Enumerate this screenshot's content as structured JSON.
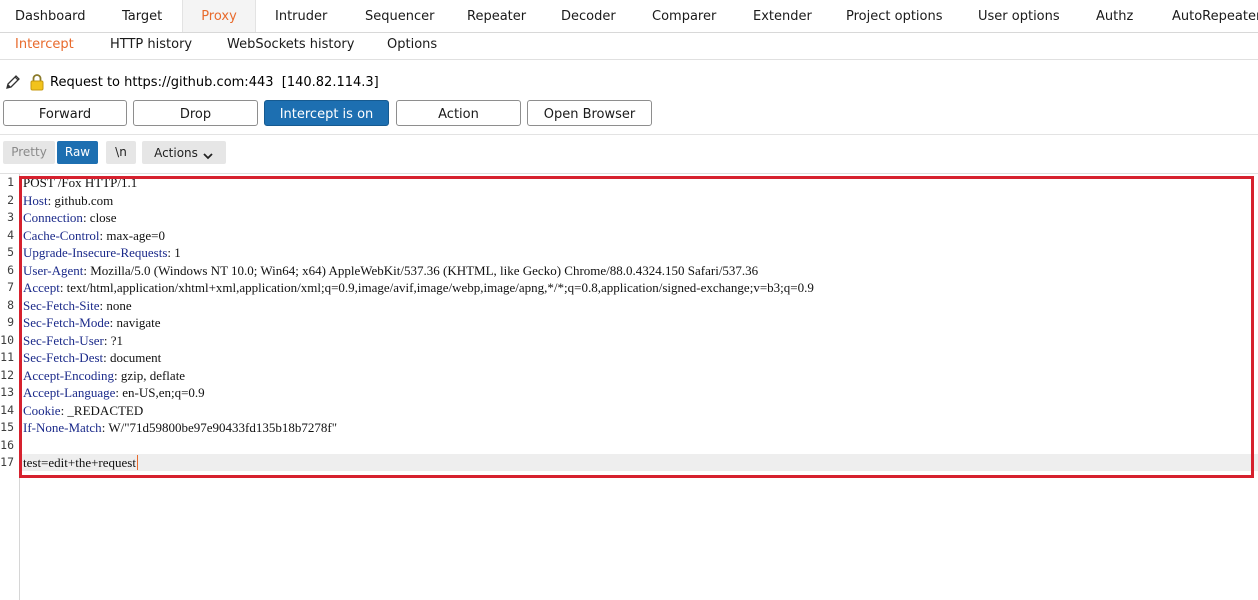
{
  "main_tabs": [
    "Dashboard",
    "Target",
    "Proxy",
    "Intruder",
    "Sequencer",
    "Repeater",
    "Decoder",
    "Comparer",
    "Extender",
    "Project options",
    "User options",
    "Authz",
    "AutoRepeater"
  ],
  "active_main_tab": "Proxy",
  "sub_tabs": [
    "Intercept",
    "HTTP history",
    "WebSockets history",
    "Options"
  ],
  "active_sub_tab": "Intercept",
  "request_info": "Request to https://github.com:443  [140.82.114.3]",
  "icons": {
    "edit": "pencil-icon",
    "lock": "lock-icon",
    "dropdown": "chevron-down-icon"
  },
  "buttons": {
    "forward": "Forward",
    "drop": "Drop",
    "intercept": "Intercept is on",
    "action": "Action",
    "open_browser": "Open Browser"
  },
  "message_view": {
    "pretty": "Pretty",
    "raw": "Raw",
    "newline": "\\n",
    "actions": "Actions"
  },
  "colors": {
    "accent": "#e86a2c",
    "primary": "#1d6fb1",
    "highlight_box": "#d6212e",
    "header_key": "#1b2a8a"
  },
  "request_lines": [
    {
      "n": "1",
      "key": "",
      "val": "POST /Fox HTTP/1.1"
    },
    {
      "n": "2",
      "key": "Host",
      "val": ": github.com"
    },
    {
      "n": "3",
      "key": "Connection",
      "val": ": close"
    },
    {
      "n": "4",
      "key": "Cache-Control",
      "val": ": max-age=0"
    },
    {
      "n": "5",
      "key": "Upgrade-Insecure-Requests",
      "val": ": 1"
    },
    {
      "n": "6",
      "key": "User-Agent",
      "val": ": Mozilla/5.0 (Windows NT 10.0; Win64; x64) AppleWebKit/537.36 (KHTML, like Gecko) Chrome/88.0.4324.150 Safari/537.36"
    },
    {
      "n": "7",
      "key": "Accept",
      "val": ": text/html,application/xhtml+xml,application/xml;q=0.9,image/avif,image/webp,image/apng,*/*;q=0.8,application/signed-exchange;v=b3;q=0.9"
    },
    {
      "n": "8",
      "key": "Sec-Fetch-Site",
      "val": ": none"
    },
    {
      "n": "9",
      "key": "Sec-Fetch-Mode",
      "val": ": navigate"
    },
    {
      "n": "10",
      "key": "Sec-Fetch-User",
      "val": ": ?1"
    },
    {
      "n": "11",
      "key": "Sec-Fetch-Dest",
      "val": ": document"
    },
    {
      "n": "12",
      "key": "Accept-Encoding",
      "val": ": gzip, deflate"
    },
    {
      "n": "13",
      "key": "Accept-Language",
      "val": ": en-US,en;q=0.9"
    },
    {
      "n": "14",
      "key": "Cookie",
      "val": ": _REDACTED"
    },
    {
      "n": "15",
      "key": "If-None-Match",
      "val": ": W/\"71d59800be97e90433fd135b18b7278f\""
    },
    {
      "n": "16",
      "key": "",
      "val": ""
    },
    {
      "n": "17",
      "key": "",
      "val": "test=edit+the+request"
    }
  ]
}
